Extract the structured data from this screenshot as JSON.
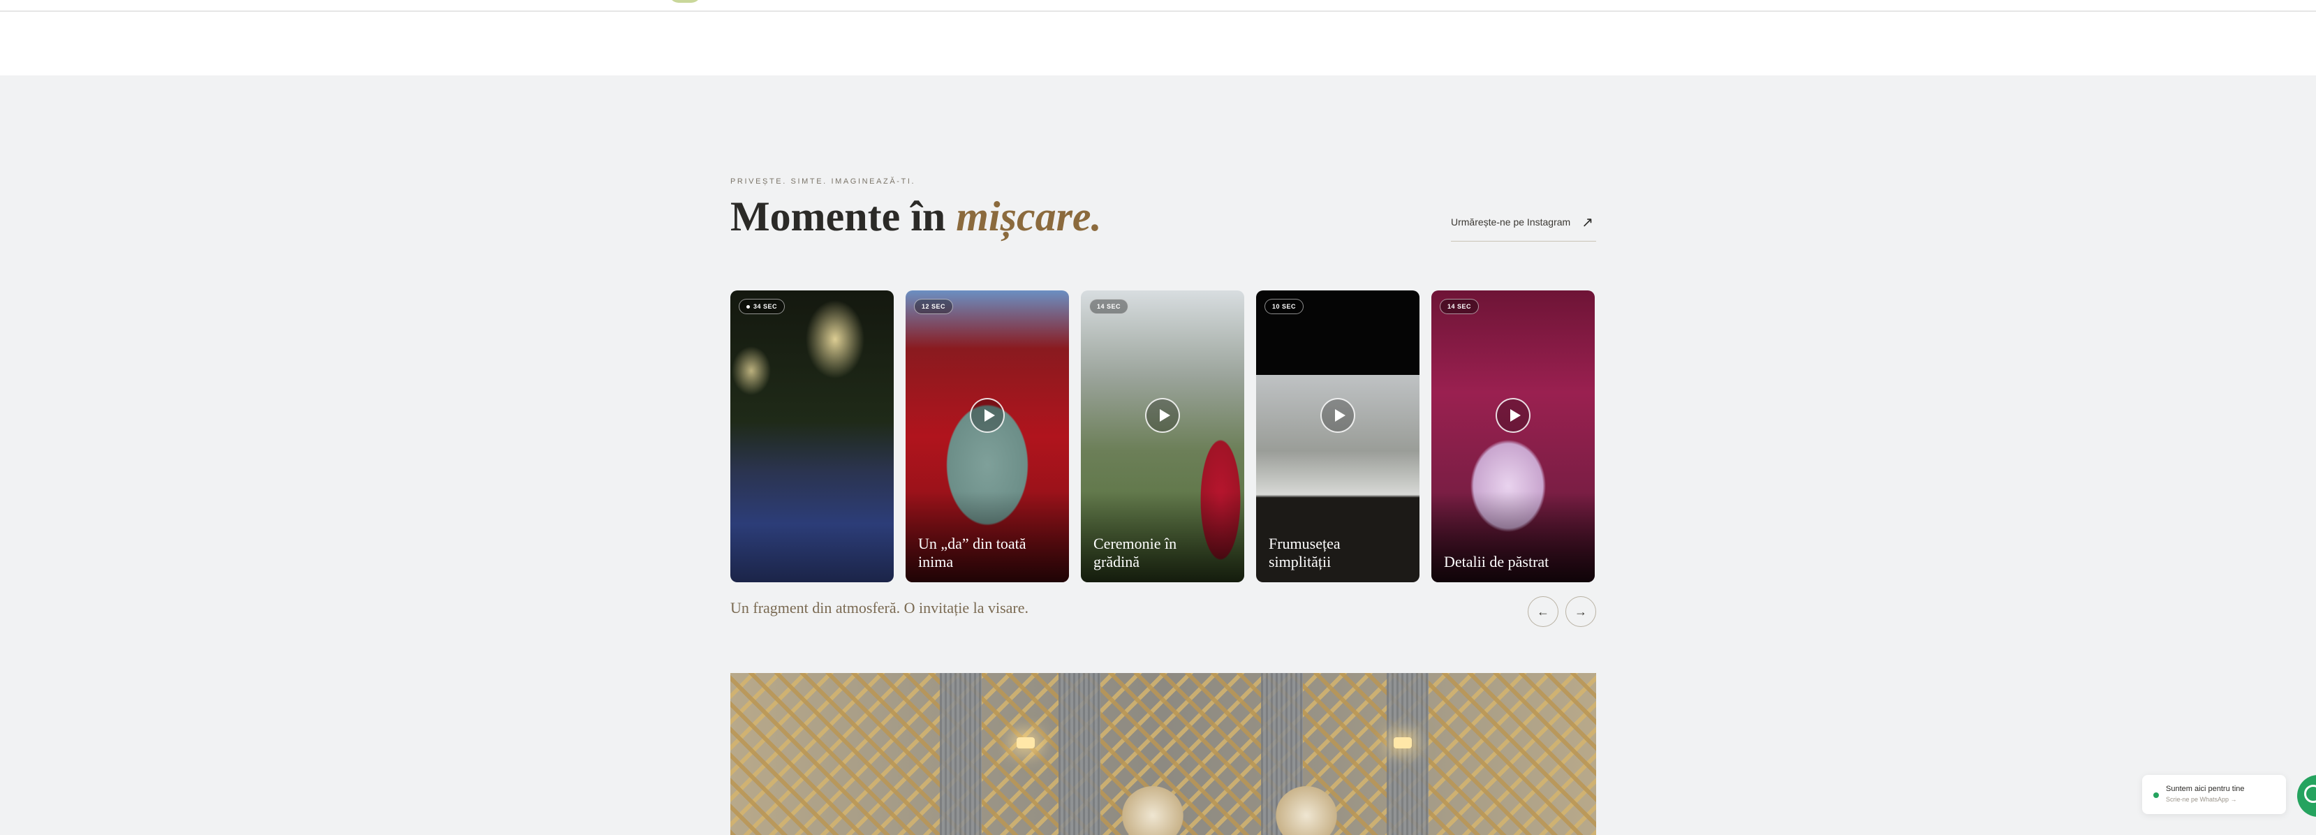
{
  "section": {
    "eyebrow": "PRIVEȘTE. SIMTE. IMAGINEAZĂ-TI.",
    "title_main": "Momente în ",
    "title_accent": "mișcare.",
    "instagram_link": "Urmărește-ne pe Instagram",
    "instagram_icon": "arrow-up-right-icon",
    "tagline": "Un fragment din atmosferă. O invitație la visare."
  },
  "videos": [
    {
      "duration": "34 SEC",
      "caption": ""
    },
    {
      "duration": "12 SEC",
      "caption": "Un „da” din toată inima"
    },
    {
      "duration": "14 SEC",
      "caption": "Ceremonie în grădină"
    },
    {
      "duration": "10 SEC",
      "caption": "Frumusețea simplității"
    },
    {
      "duration": "14 SEC",
      "caption": "Detalii de păstrat"
    }
  ],
  "carousel": {
    "prev_icon": "arrow-left-icon",
    "next_icon": "arrow-right-icon",
    "prev_label": "←",
    "next_label": "→"
  },
  "whatsapp": {
    "title": "Suntem aici pentru tine",
    "subtitle": "Scrie-ne pe WhatsApp →",
    "icon": "whatsapp-icon"
  },
  "colors": {
    "background": "#f1f2f3",
    "accent": "#8b6a3d",
    "whatsapp": "#25a35f"
  }
}
